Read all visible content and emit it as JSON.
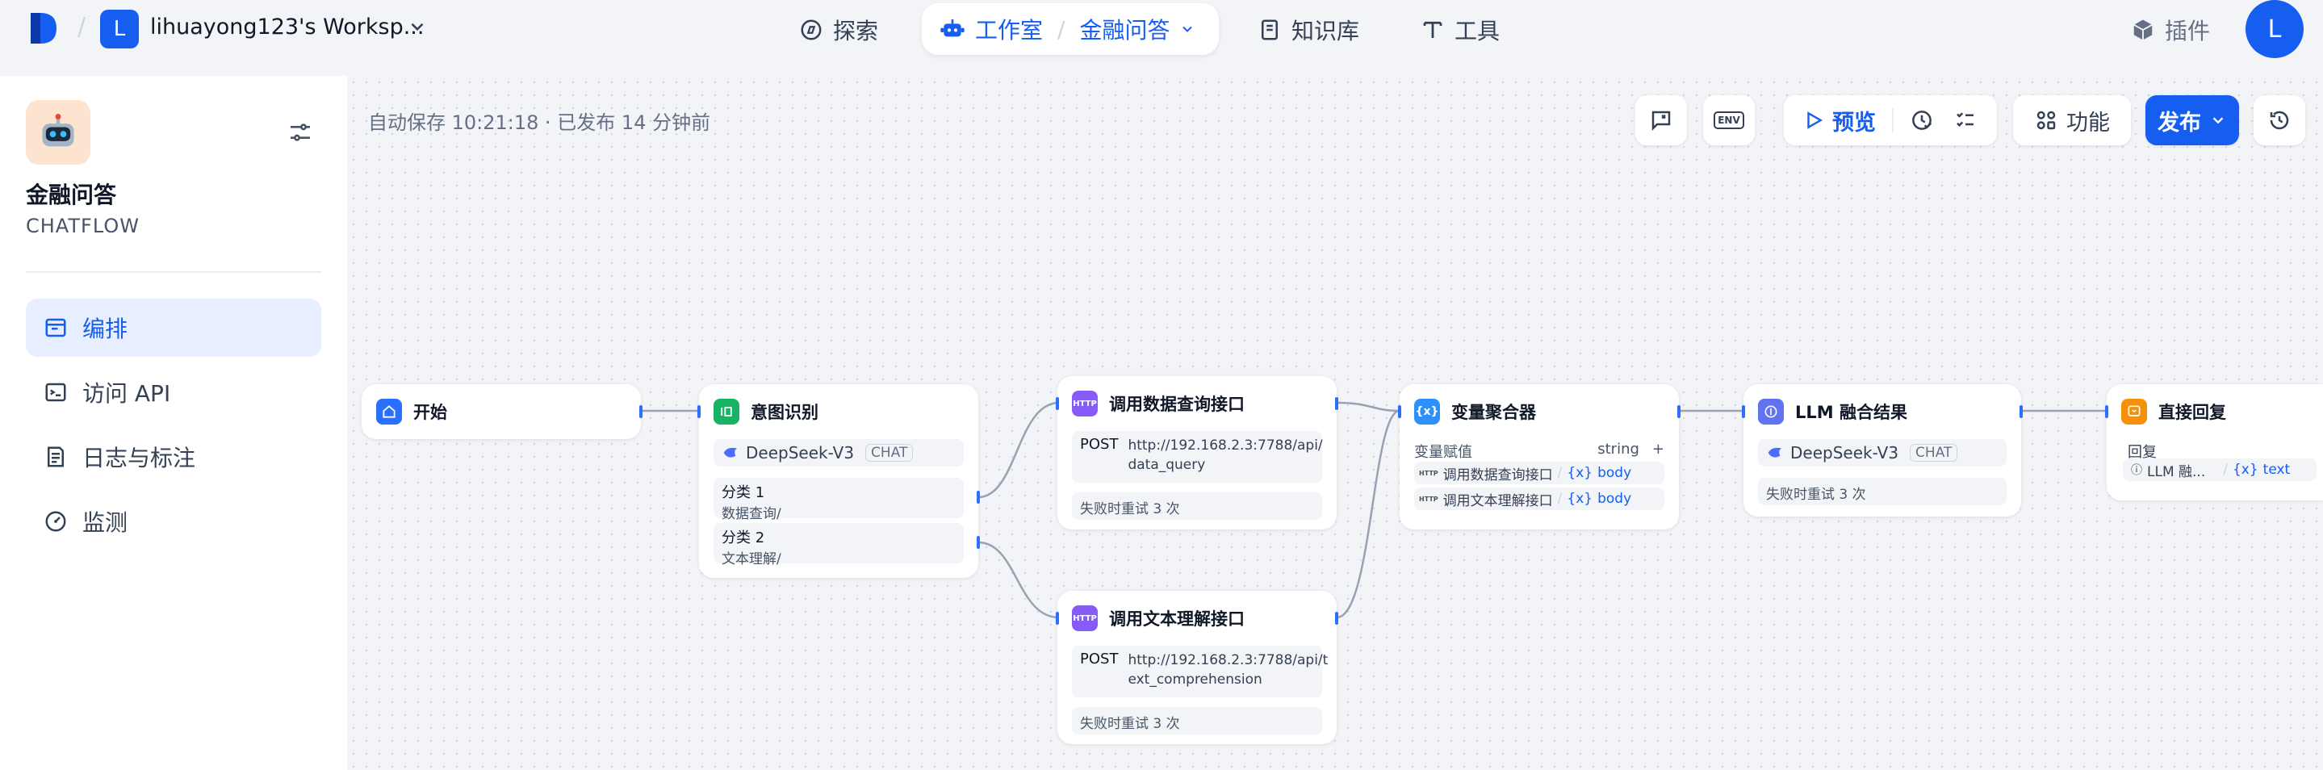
{
  "header": {
    "workspace_initial": "L",
    "workspace_name": "lihuayong123's Worksp...",
    "nav": {
      "explore": "探索",
      "studio": "工作室",
      "current_app": "金融问答",
      "knowledge": "知识库",
      "tools": "工具",
      "plugins": "插件"
    },
    "user_initial": "L"
  },
  "sidebar": {
    "app_name": "金融问答",
    "app_type": "CHATFLOW",
    "items": [
      {
        "label": "编排",
        "icon": "layout-icon",
        "active": true
      },
      {
        "label": "访问 API",
        "icon": "terminal-icon",
        "active": false
      },
      {
        "label": "日志与标注",
        "icon": "log-icon",
        "active": false
      },
      {
        "label": "监测",
        "icon": "gauge-icon",
        "active": false
      }
    ]
  },
  "toolbar": {
    "autosave": "自动保存 10:21:18 · 已发布 14 分钟前",
    "env_label": "ENV",
    "preview": "预览",
    "features": "功能",
    "publish": "发布"
  },
  "colors": {
    "accent": "#155eef",
    "start": "#2970ff",
    "classifier": "#16b364",
    "http": "#875bf7",
    "aggregator": "#2e90fa",
    "llm": "#6172f3",
    "answer": "#f79009"
  },
  "nodes": {
    "start": {
      "title": "开始"
    },
    "classifier": {
      "title": "意图识别",
      "model": "DeepSeek-V3",
      "model_tag": "CHAT",
      "classes": [
        {
          "name": "分类 1",
          "desc": "数据查询/"
        },
        {
          "name": "分类 2",
          "desc": "文本理解/"
        }
      ]
    },
    "http1": {
      "title": "调用数据查询接口",
      "method": "POST",
      "url_line1": "http://192.168.2.3:7788/api/",
      "url_line2": "data_query",
      "retry": "失败时重试 3 次"
    },
    "http2": {
      "title": "调用文本理解接口",
      "method": "POST",
      "url_line1": "http://192.168.2.3:7788/api/t",
      "url_line2": "ext_comprehension",
      "retry": "失败时重试 3 次"
    },
    "aggregator": {
      "title": "变量聚合器",
      "label": "变量赋值",
      "type": "string",
      "add": "+",
      "vars": [
        {
          "source": "调用数据查询接口",
          "name": "body"
        },
        {
          "source": "调用文本理解接口",
          "name": "body"
        }
      ]
    },
    "llm": {
      "title": "LLM 融合结果",
      "model": "DeepSeek-V3",
      "model_tag": "CHAT",
      "retry": "失败时重试 3 次"
    },
    "answer": {
      "title": "直接回复",
      "label": "回复",
      "source": "LLM 融...",
      "var": "text"
    }
  }
}
